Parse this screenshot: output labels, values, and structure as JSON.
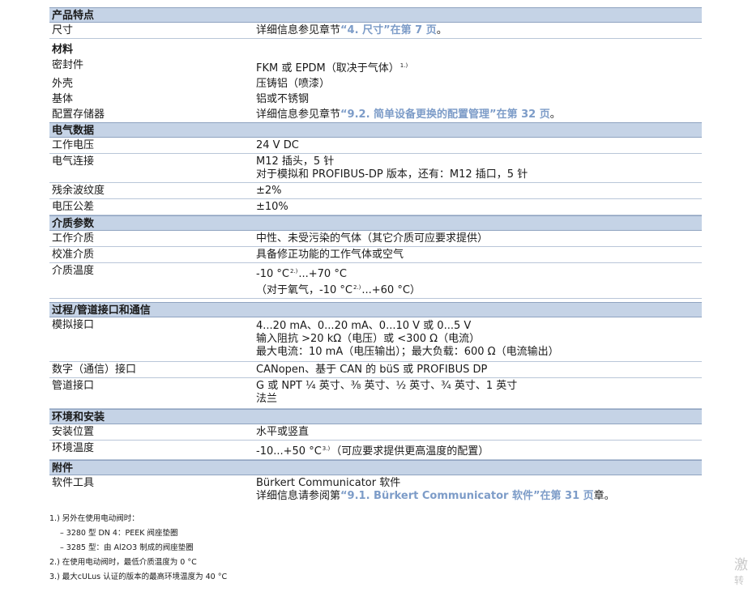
{
  "sections": {
    "features": {
      "title": "产品特点",
      "size_label": "尺寸",
      "size_pre": "详细信息参见章节",
      "size_link": "“4. 尺寸”在第 7 页",
      "size_post": "。"
    },
    "material": {
      "title": "材料",
      "seal_label": "密封件",
      "seal_value": "FKM 或 EPDM（取决于气体）",
      "seal_sup": "1.)",
      "housing_label": "外壳",
      "housing_value": "压铸铝（喷漆）",
      "base_label": "基体",
      "base_value": "铝或不锈钢",
      "memory_label": "配置存储器",
      "memory_pre": "详细信息参见章节",
      "memory_link": "“9.2. 简单设备更换的配置管理”在第 32 页",
      "memory_post": "。"
    },
    "electrical": {
      "title": "电气数据",
      "voltage_label": "工作电压",
      "voltage_value": "24 V DC",
      "connection_label": "电气连接",
      "connection_line1": "M12 插头，5 针",
      "connection_line2": "对于模拟和 PROFIBUS-DP 版本，还有：M12 插口，5 针",
      "ripple_label": "残余波纹度",
      "ripple_value": "±2%",
      "tolerance_label": "电压公差",
      "tolerance_value": "±10%"
    },
    "media": {
      "title": "介质参数",
      "medium_label": "工作介质",
      "medium_value": "中性、未受污染的气体（其它介质可应要求提供）",
      "calib_label": "校准介质",
      "calib_value": "具备修正功能的工作气体或空气",
      "temp_label": "介质温度",
      "temp_a": "-10 °C",
      "temp_sup": "2.)",
      "temp_b": "...+70 °C",
      "temp2_a": "（对于氧气，-10 °C",
      "temp2_sup": "2.)",
      "temp2_b": "...+60 °C）"
    },
    "process": {
      "title": "过程/管道接口和通信",
      "analog_label": "模拟接口",
      "analog_line1": "4...20 mA、0...20 mA、0...10 V 或 0...5 V",
      "analog_line2": "输入阻抗 >20 kΩ（电压）或 <300 Ω（电流）",
      "analog_line3": "最大电流：10 mA（电压输出）；最大负载：600 Ω（电流输出）",
      "digital_label": "数字（通信）接口",
      "digital_value": "CANopen、基于 CAN 的 büS 或 PROFIBUS DP",
      "pipe_label": "管道接口",
      "pipe_line1": "G 或 NPT ¼ 英寸、⅜ 英寸、½ 英寸、¾ 英寸、1 英寸",
      "pipe_line2": "法兰"
    },
    "environment": {
      "title": "环境和安装",
      "position_label": "安装位置",
      "position_value": "水平或竖直",
      "ambient_label": "环境温度",
      "ambient_a": "-10...+50 °C",
      "ambient_sup": "3.)",
      "ambient_b": "（可应要求提供更高温度的配置）"
    },
    "accessories": {
      "title": "附件",
      "software_label": "软件工具",
      "software_line1": "Bürkert Communicator 软件",
      "software_pre": "详细信息请参阅第",
      "software_link": "“9.1. Bürkert Communicator 软件”在第 31 页",
      "software_post": "章。"
    }
  },
  "footnotes": {
    "n1": "1.) 另外在使用电动阀时：",
    "n1a": "– 3280 型 DN 4：PEEK 阀座垫圈",
    "n1b": "– 3285 型：由 Al2O3 制成的阀座垫圈",
    "n2": "2.) 在使用电动阀时，最低介质温度为 0 °C",
    "n3": "3.) 最大cULus 认证的版本的最高环境温度为 40 °C"
  },
  "watermark": {
    "line1": "激",
    "line2": "转"
  },
  "colors": {
    "section_fill": "#c5d3e6",
    "link": "#7d9cc8"
  }
}
